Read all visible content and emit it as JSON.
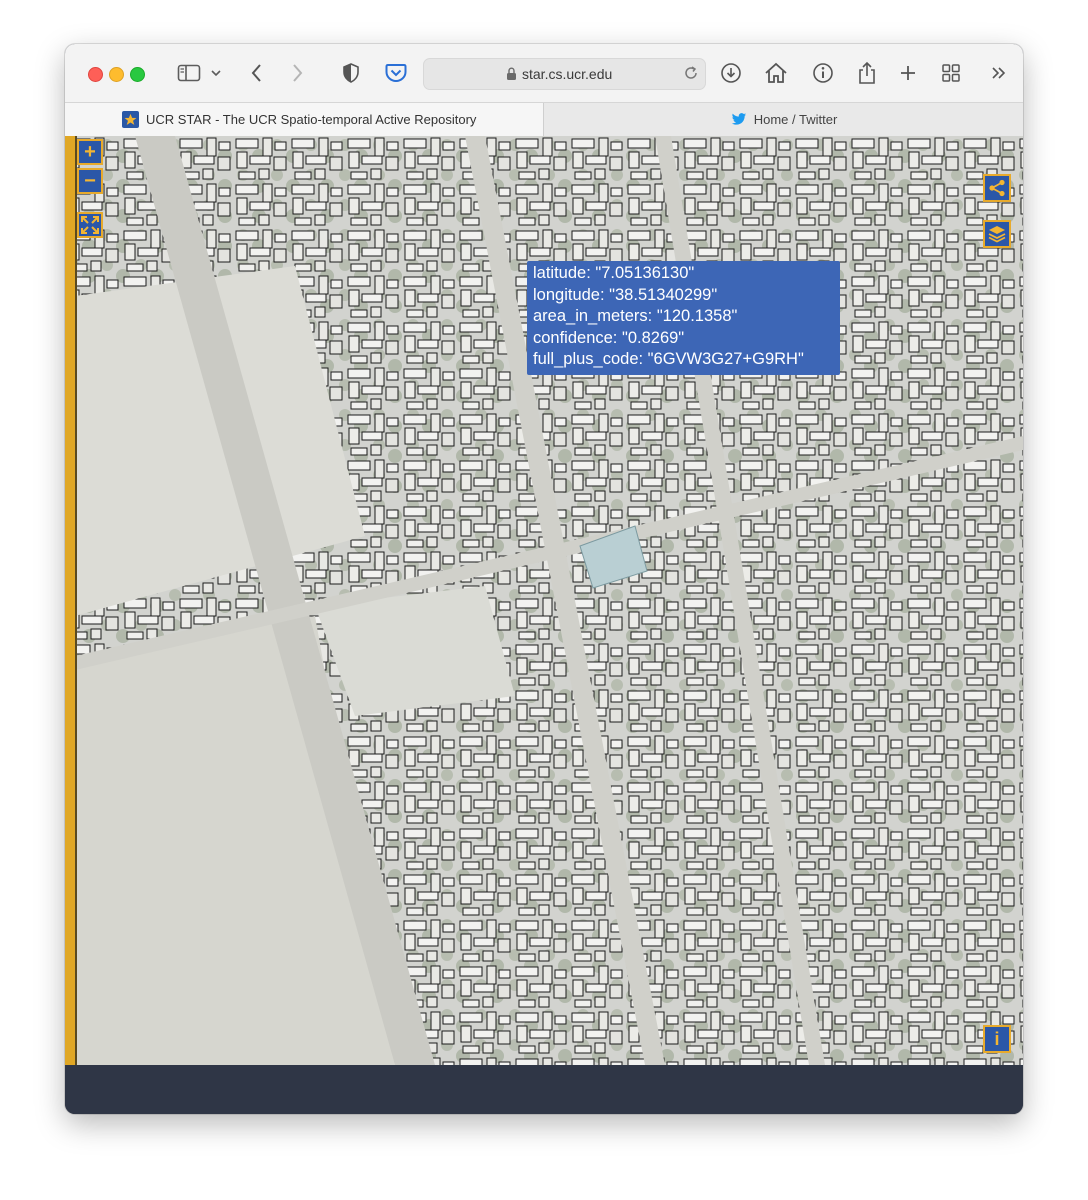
{
  "browser": {
    "address_bar": {
      "url": "star.cs.ucr.edu"
    },
    "tabs": [
      {
        "title": "UCR STAR - The UCR Spatio-temporal Active Repository",
        "active": true
      },
      {
        "title": "Home / Twitter",
        "active": false
      }
    ]
  },
  "map": {
    "controls": {
      "zoom_in": "+",
      "zoom_out": "−",
      "info": "i"
    },
    "popup": {
      "lines": [
        "latitude: \"7.05136130\"",
        "longitude: \"38.51340299\"",
        "area_in_meters: \"120.1358\"",
        "confidence: \"0.8269\"",
        "full_plus_code: \"6GVW3G27+G9RH\""
      ]
    }
  },
  "colors": {
    "control_blue": "#2b57a8",
    "control_gold": "#e7aa2c",
    "popup_blue": "#3d66b6",
    "footer": "#2f3646"
  }
}
